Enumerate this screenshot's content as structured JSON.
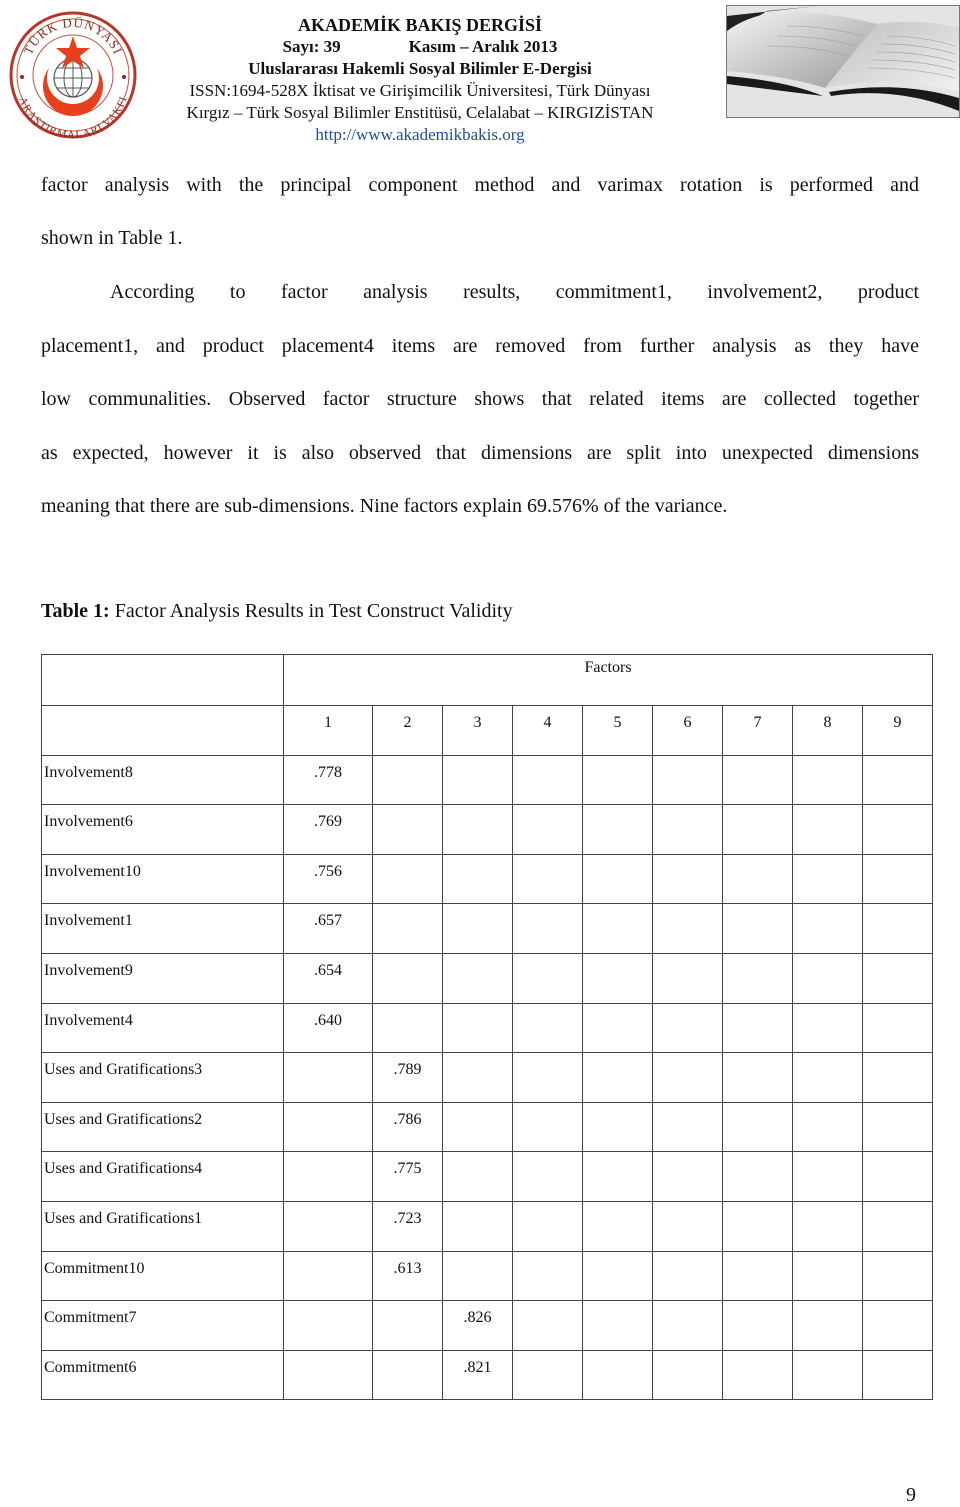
{
  "header": {
    "logo": {
      "icon": "turk-dunyasi-arastirmalari-vakfi-seal-icon",
      "top_text": "TÜRK DÜNYASI",
      "bottom_text": "ARAŞTIRMALARI VAKFI",
      "colors": {
        "red": "#e8401c",
        "ring": "#c0392b"
      }
    },
    "journal_title": "AKADEMİK BAKIŞ DERGİSİ",
    "issue": "Sayı: 39",
    "period": "Kasım – Aralık 2013",
    "subtitle": "Uluslararası Hakemli Sosyal Bilimler E-Dergisi",
    "issn_line": "ISSN:1694-528X İktisat ve Girişimcilik Üniversitesi, Türk Dünyası",
    "institute_line": "Kırgız – Türk Sosyal Bilimler Enstitüsü, Celalabat – KIRGIZİSTAN",
    "url": "http://www.akademikbakis.org",
    "url_color": "#1f4e9a",
    "book_image": "open-book-photo-icon"
  },
  "body": {
    "paragraph1_lines": [
      "factor analysis with the principal component method and varimax rotation is performed and",
      "shown in Table 1."
    ],
    "paragraph2_lines": [
      "According   to   factor   analysis   results,   commitment1,   involvement2,   product",
      "placement1, and product placement4 items are removed from further analysis as they have",
      "low communalities. Observed factor structure shows that related items are collected together",
      "as expected, however it is also observed that dimensions are split into unexpected dimensions",
      "meaning that there are sub-dimensions. Nine factors explain 69.576% of the variance."
    ]
  },
  "table": {
    "caption_label": "Table 1:",
    "caption_text": " Factor Analysis Results in Test Construct Validity",
    "group_header": "Factors",
    "factor_numbers": [
      "1",
      "2",
      "3",
      "4",
      "5",
      "6",
      "7",
      "8",
      "9"
    ],
    "rows": [
      {
        "item": "Involvement8",
        "loadings": [
          ".778",
          "",
          "",
          "",
          "",
          "",
          "",
          "",
          ""
        ]
      },
      {
        "item": "Involvement6",
        "loadings": [
          ".769",
          "",
          "",
          "",
          "",
          "",
          "",
          "",
          ""
        ]
      },
      {
        "item": "Involvement10",
        "loadings": [
          ".756",
          "",
          "",
          "",
          "",
          "",
          "",
          "",
          ""
        ]
      },
      {
        "item": "Involvement1",
        "loadings": [
          ".657",
          "",
          "",
          "",
          "",
          "",
          "",
          "",
          ""
        ]
      },
      {
        "item": "Involvement9",
        "loadings": [
          ".654",
          "",
          "",
          "",
          "",
          "",
          "",
          "",
          ""
        ]
      },
      {
        "item": "Involvement4",
        "loadings": [
          ".640",
          "",
          "",
          "",
          "",
          "",
          "",
          "",
          ""
        ]
      },
      {
        "item": "Uses and Gratifications3",
        "loadings": [
          "",
          ".789",
          "",
          "",
          "",
          "",
          "",
          "",
          ""
        ]
      },
      {
        "item": "Uses and Gratifications2",
        "loadings": [
          "",
          ".786",
          "",
          "",
          "",
          "",
          "",
          "",
          ""
        ]
      },
      {
        "item": "Uses and Gratifications4",
        "loadings": [
          "",
          ".775",
          "",
          "",
          "",
          "",
          "",
          "",
          ""
        ]
      },
      {
        "item": "Uses and Gratifications1",
        "loadings": [
          "",
          ".723",
          "",
          "",
          "",
          "",
          "",
          "",
          ""
        ]
      },
      {
        "item": "Commitment10",
        "loadings": [
          "",
          ".613",
          "",
          "",
          "",
          "",
          "",
          "",
          ""
        ]
      },
      {
        "item": "Commitment7",
        "loadings": [
          "",
          "",
          ".826",
          "",
          "",
          "",
          "",
          "",
          ""
        ]
      },
      {
        "item": "Commitment6",
        "loadings": [
          "",
          "",
          ".821",
          "",
          "",
          "",
          "",
          "",
          ""
        ]
      }
    ]
  },
  "footer": {
    "page_number": "9"
  }
}
